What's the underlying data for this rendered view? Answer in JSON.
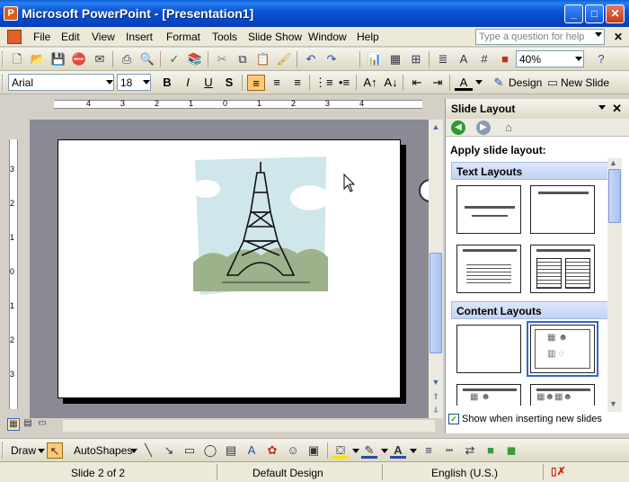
{
  "window": {
    "title": "Microsoft PowerPoint - [Presentation1]",
    "minimize": "_",
    "maximize": "□",
    "close": "✕"
  },
  "menu": {
    "items": [
      "File",
      "Edit",
      "View",
      "Insert",
      "Format",
      "Tools",
      "Slide Show",
      "Window",
      "Help"
    ],
    "help_placeholder": "Type a question for help",
    "close_doc": "✕"
  },
  "standard_toolbar": {
    "zoom": "40%"
  },
  "formatting_toolbar": {
    "font": "Arial",
    "size": "18",
    "design_label": "Design",
    "new_slide_label": "New Slide"
  },
  "ruler": {
    "h_numbers": [
      "4",
      "3",
      "2",
      "1",
      "0",
      "1",
      "2",
      "3",
      "4"
    ],
    "v_numbers": [
      "3",
      "2",
      "1",
      "0",
      "1",
      "2",
      "3"
    ]
  },
  "task_pane": {
    "title": "Slide Layout",
    "apply_label": "Apply slide layout:",
    "sections": [
      "Text Layouts",
      "Content Layouts"
    ],
    "show_insert_label": "Show when inserting new slides"
  },
  "drawing_toolbar": {
    "draw_label": "Draw",
    "autoshapes_label": "AutoShapes"
  },
  "status": {
    "slide": "Slide 2 of 2",
    "design": "Default Design",
    "language": "English (U.S.)"
  },
  "colors": {
    "title_bar": "#0b56d6",
    "canvas": "#8a8a94",
    "active_button": "#ffc875"
  }
}
